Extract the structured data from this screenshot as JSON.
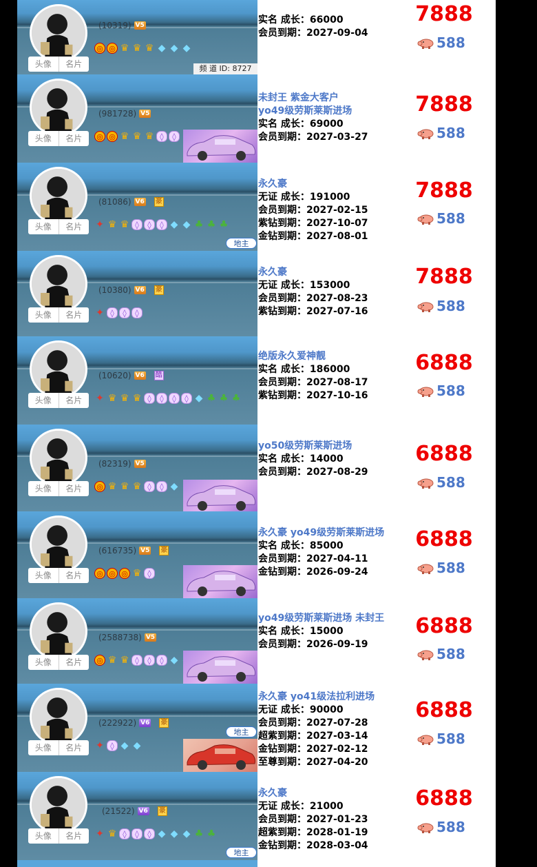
{
  "tabs": {
    "avatar": "头像",
    "card": "名片"
  },
  "channel_id": "频 道 ID:   8727",
  "dizhu_label": "地主",
  "hao_label": "豪",
  "ku_label": "酷",
  "rows": [
    {
      "id": "(10319)",
      "vip": "V5",
      "price": "7888",
      "pig": "588",
      "lines": [
        {
          "text": "实名   成长：66000",
          "tag": false
        },
        {
          "text": "会员到期：2027-09-04",
          "tag": false
        }
      ],
      "icons": [
        "red",
        "red",
        "crown",
        "crown",
        "crown",
        "dia",
        "dia",
        "dia"
      ]
    },
    {
      "id": "(981728)",
      "vip": "V5",
      "price": "7888",
      "pig": "588",
      "lines": [
        {
          "text": "未封王  紫金大客户",
          "tag": true
        },
        {
          "text": "yo49级劳斯莱斯进场",
          "tag": true
        },
        {
          "text": "实名   成长：69000",
          "tag": false
        },
        {
          "text": "会员到期：2027-03-27",
          "tag": false
        }
      ],
      "icons": [
        "red",
        "red",
        "crown",
        "crown",
        "crown",
        "purp",
        "purp"
      ]
    },
    {
      "id": "(81086)",
      "vip": "V6",
      "price": "7888",
      "pig": "588",
      "lines": [
        {
          "text": "永久豪",
          "tag": true
        },
        {
          "text": "无证   成长：191000",
          "tag": false
        },
        {
          "text": "会员到期：2027-02-15",
          "tag": false
        },
        {
          "text": "紫钻到期：2027-10-07",
          "tag": false
        },
        {
          "text": "金钻到期：2027-08-01",
          "tag": false
        }
      ],
      "icons": [
        "bird",
        "crown",
        "crown",
        "purp",
        "purp",
        "purp",
        "dia",
        "dia",
        "leaf",
        "leaf",
        "leaf"
      ]
    },
    {
      "id": "(10380)",
      "vip": "V6",
      "price": "7888",
      "pig": "588",
      "lines": [
        {
          "text": "永久豪",
          "tag": true
        },
        {
          "text": "无证   成长：153000",
          "tag": false
        },
        {
          "text": "会员到期：2027-08-23",
          "tag": false
        },
        {
          "text": "紫钻到期：2027-07-16",
          "tag": false
        }
      ],
      "icons": [
        "bird",
        "purp",
        "purp",
        "purp"
      ]
    },
    {
      "id": "(10620)",
      "vip": "V6",
      "price": "6888",
      "pig": "588",
      "lines": [
        {
          "text": "绝版永久爱神靓",
          "tag": true
        },
        {
          "text": "实名   成长：186000",
          "tag": false
        },
        {
          "text": "会员到期：2027-08-17",
          "tag": false
        },
        {
          "text": "紫钻到期：2027-10-16",
          "tag": false
        }
      ],
      "icons": [
        "bird",
        "crown",
        "crown",
        "crown",
        "purp",
        "purp",
        "purp",
        "purp",
        "dia",
        "leaf",
        "leaf",
        "leaf"
      ]
    },
    {
      "id": "(82319)",
      "vip": "V5",
      "price": "6888",
      "pig": "588",
      "lines": [
        {
          "text": "yo50级劳斯莱斯进场",
          "tag": true
        },
        {
          "text": "实名   成长：14000",
          "tag": false
        },
        {
          "text": "会员到期：2027-08-29",
          "tag": false
        }
      ],
      "icons": [
        "red",
        "crown",
        "crown",
        "crown",
        "purp",
        "purp",
        "dia"
      ]
    },
    {
      "id": "(616735)",
      "vip": "V5",
      "price": "6888",
      "pig": "588",
      "lines": [
        {
          "text": "永久豪   yo49级劳斯莱斯进场",
          "tag": true
        },
        {
          "text": "实名   成长：85000",
          "tag": false
        },
        {
          "text": "会员到期：2027-04-11",
          "tag": false
        },
        {
          "text": "金钻到期：2026-09-24",
          "tag": false
        }
      ],
      "icons": [
        "red",
        "red",
        "red",
        "crown",
        "purp"
      ]
    },
    {
      "id": "(2588738)",
      "vip": "V5",
      "price": "6888",
      "pig": "588",
      "lines": [
        {
          "text": "yo49级劳斯莱斯进场  未封王",
          "tag": true
        },
        {
          "text": "实名   成长：15000",
          "tag": false
        },
        {
          "text": "会员到期：2026-09-19",
          "tag": false
        }
      ],
      "icons": [
        "red",
        "crown",
        "crown",
        "purp",
        "purp",
        "purp",
        "dia",
        "dia"
      ]
    },
    {
      "id": "(222922)",
      "vip": "V6",
      "price": "6888",
      "pig": "588",
      "lines": [
        {
          "text": "永久豪   yo41级法拉利进场",
          "tag": true
        },
        {
          "text": "无证   成长：90000",
          "tag": false
        },
        {
          "text": "会员到期：2027-07-28",
          "tag": false
        },
        {
          "text": "超紫到期：2027-03-14",
          "tag": false
        },
        {
          "text": "金钻到期：2027-02-12",
          "tag": false
        },
        {
          "text": "至尊到期：2027-04-20",
          "tag": false
        }
      ],
      "icons": [
        "bird",
        "purp",
        "dia",
        "dia"
      ]
    },
    {
      "id": "(21522)",
      "vip": "V6",
      "price": "6888",
      "pig": "588",
      "lines": [
        {
          "text": "永久豪",
          "tag": true
        },
        {
          "text": "无证   成长：21000",
          "tag": false
        },
        {
          "text": "会员到期：2027-01-23",
          "tag": false
        },
        {
          "text": "超紫到期：2028-01-19",
          "tag": false
        },
        {
          "text": "金钻到期：2028-03-04",
          "tag": false
        }
      ],
      "icons": [
        "bird",
        "crown",
        "purp",
        "purp",
        "purp",
        "dia",
        "dia",
        "dia",
        "leaf",
        "leaf"
      ]
    }
  ]
}
